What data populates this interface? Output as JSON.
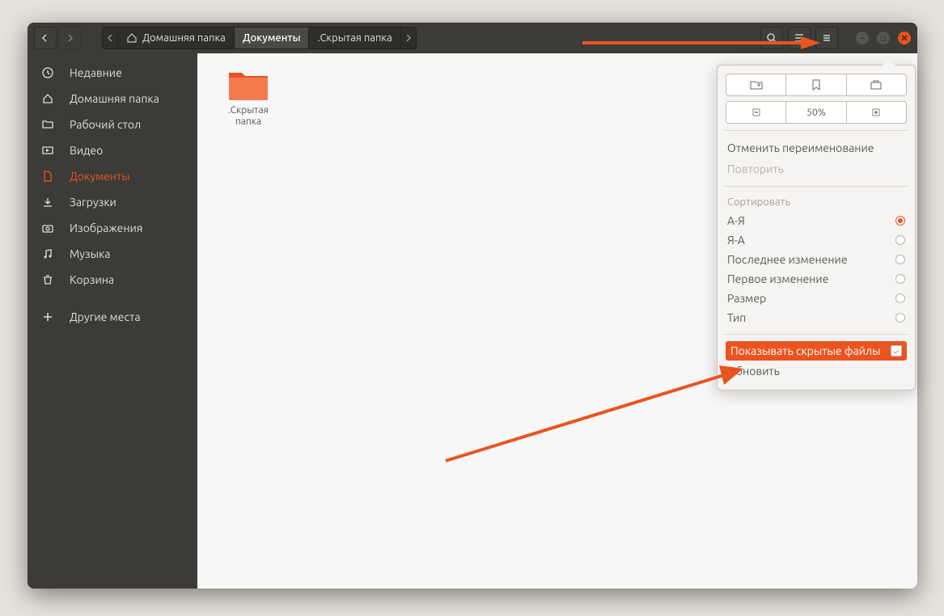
{
  "breadcrumb": {
    "home": "Домашняя папка",
    "documents": "Документы",
    "hidden_folder": ".Скрытая папка"
  },
  "sidebar": {
    "items": [
      {
        "label": "Недавние",
        "icon": "clock-icon"
      },
      {
        "label": "Домашняя папка",
        "icon": "home-icon"
      },
      {
        "label": "Рабочий стол",
        "icon": "folder-icon"
      },
      {
        "label": "Видео",
        "icon": "video-icon"
      },
      {
        "label": "Документы",
        "icon": "document-icon",
        "active": true
      },
      {
        "label": "Загрузки",
        "icon": "download-icon"
      },
      {
        "label": "Изображения",
        "icon": "camera-icon"
      },
      {
        "label": "Музыка",
        "icon": "music-icon"
      },
      {
        "label": "Корзина",
        "icon": "trash-icon"
      }
    ],
    "other_places": "Другие места"
  },
  "content": {
    "folder_name": ".Скрытая\nпапка"
  },
  "popover": {
    "zoom": "50%",
    "undo": "Отменить переименование",
    "redo": "Повторить",
    "sort_label": "Сортировать",
    "sort_options": [
      {
        "label": "А-Я",
        "selected": true
      },
      {
        "label": "Я-А",
        "selected": false
      },
      {
        "label": "Последнее изменение",
        "selected": false
      },
      {
        "label": "Первое изменение",
        "selected": false
      },
      {
        "label": "Размер",
        "selected": false
      },
      {
        "label": "Тип",
        "selected": false
      }
    ],
    "show_hidden": "Показывать скрытые файлы",
    "reload": "Обновить"
  }
}
